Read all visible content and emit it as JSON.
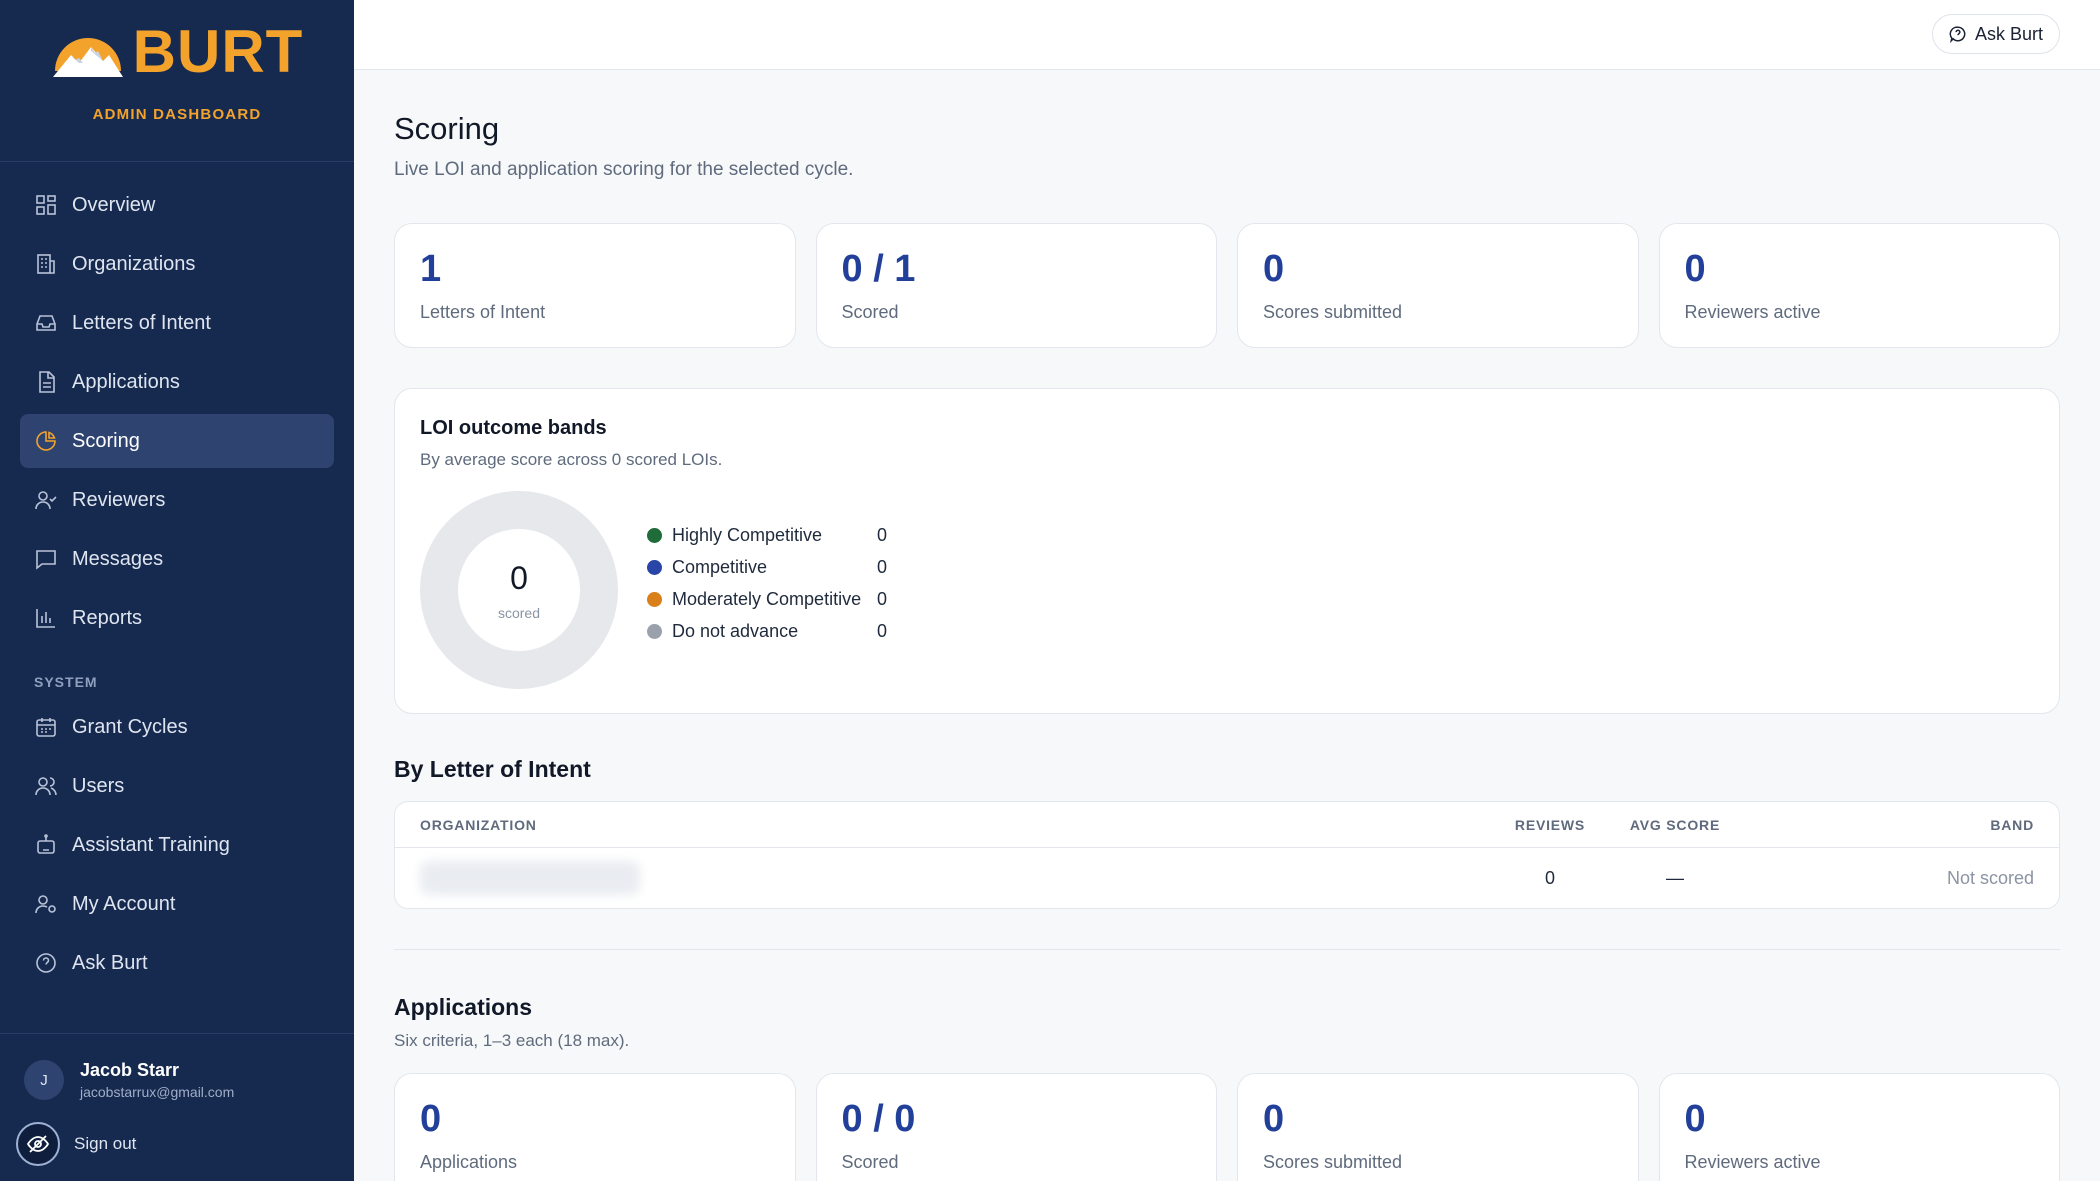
{
  "brand": {
    "name": "BURT",
    "subtitle": "ADMIN DASHBOARD",
    "accent": "#f3a32b"
  },
  "sidebar": {
    "items": [
      {
        "label": "Overview",
        "icon": "grid-icon"
      },
      {
        "label": "Organizations",
        "icon": "building-icon"
      },
      {
        "label": "Letters of Intent",
        "icon": "inbox-icon"
      },
      {
        "label": "Applications",
        "icon": "document-icon"
      },
      {
        "label": "Scoring",
        "icon": "pie-chart-icon",
        "active": true
      },
      {
        "label": "Reviewers",
        "icon": "user-check-icon"
      },
      {
        "label": "Messages",
        "icon": "message-icon"
      },
      {
        "label": "Reports",
        "icon": "bar-chart-icon"
      }
    ],
    "system_label": "SYSTEM",
    "system_items": [
      {
        "label": "Grant Cycles",
        "icon": "calendar-icon"
      },
      {
        "label": "Users",
        "icon": "users-icon"
      },
      {
        "label": "Assistant Training",
        "icon": "bot-icon"
      },
      {
        "label": "My Account",
        "icon": "user-gear-icon"
      },
      {
        "label": "Ask Burt",
        "icon": "help-circle-icon"
      }
    ],
    "user": {
      "initial": "J",
      "name": "Jacob Starr",
      "email": "jacobstarrux@gmail.com"
    },
    "sign_out": "Sign out"
  },
  "topbar": {
    "ask_label": "Ask Burt"
  },
  "page": {
    "title": "Scoring",
    "subtitle": "Live LOI and application scoring for the selected cycle."
  },
  "loi_stats": [
    {
      "value": "1",
      "label": "Letters of Intent"
    },
    {
      "value": "0 / 1",
      "label": "Scored"
    },
    {
      "value": "0",
      "label": "Scores submitted"
    },
    {
      "value": "0",
      "label": "Reviewers active"
    }
  ],
  "bands": {
    "title": "LOI outcome bands",
    "subtitle": "By average score across 0 scored LOIs.",
    "center_value": "0",
    "center_caption": "scored",
    "legend": [
      {
        "label": "Highly Competitive",
        "value": "0",
        "color": "#1f6b3a"
      },
      {
        "label": "Competitive",
        "value": "0",
        "color": "#2a45a8"
      },
      {
        "label": "Moderately Competitive",
        "value": "0",
        "color": "#d9801a"
      },
      {
        "label": "Do not advance",
        "value": "0",
        "color": "#9aa1ad"
      }
    ]
  },
  "by_loi": {
    "title": "By Letter of Intent",
    "columns": {
      "organization": "ORGANIZATION",
      "reviews": "REVIEWS",
      "avg_score": "AVG SCORE",
      "band": "BAND"
    },
    "rows": [
      {
        "reviews": "0",
        "avg_score": "—",
        "band": "Not scored"
      }
    ]
  },
  "applications": {
    "title": "Applications",
    "subtitle": "Six criteria, 1–3 each (18 max).",
    "stats": [
      {
        "value": "0",
        "label": "Applications"
      },
      {
        "value": "0 / 0",
        "label": "Scored"
      },
      {
        "value": "0",
        "label": "Scores submitted"
      },
      {
        "value": "0",
        "label": "Reviewers active"
      }
    ]
  }
}
